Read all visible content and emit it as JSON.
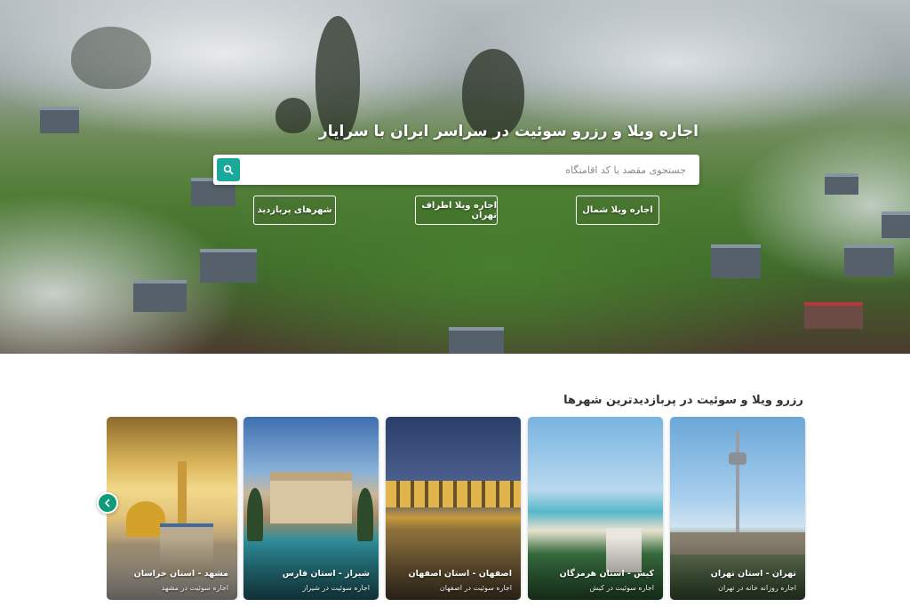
{
  "hero": {
    "title": "اجاره ویلا و رزرو سوئیت در سراسر ایران با سرایار",
    "search": {
      "placeholder": "جستجوی مقصد یا کد اقامتگاه",
      "icon": "search-icon"
    },
    "quick_links": [
      {
        "label": "اجاره ویلا شمال"
      },
      {
        "label": "اجاره ویلا اطراف تهران"
      },
      {
        "label": "شهرهای پربازدید"
      }
    ]
  },
  "popular": {
    "title": "رزرو ویلا و سوئیت در پربازدیدترین شهرها",
    "cards": [
      {
        "title": "تهران - استان تهران",
        "subtitle": "اجاره روزانه خانه در تهران"
      },
      {
        "title": "کیش - استان هرمزگان",
        "subtitle": "اجاره سوئیت در کیش"
      },
      {
        "title": "اصفهان - استان اصفهان",
        "subtitle": "اجاره سوئیت در اصفهان"
      },
      {
        "title": "شیراز - استان فارس",
        "subtitle": "اجاره سوئیت در شیراز"
      },
      {
        "title": "مشهد - استان خراسان",
        "subtitle": "اجاره سوئیت در مشهد"
      }
    ],
    "prev_icon": "chevron-left-icon"
  },
  "colors": {
    "accent": "#18a99b",
    "carousel_button": "#0f9a7a"
  }
}
